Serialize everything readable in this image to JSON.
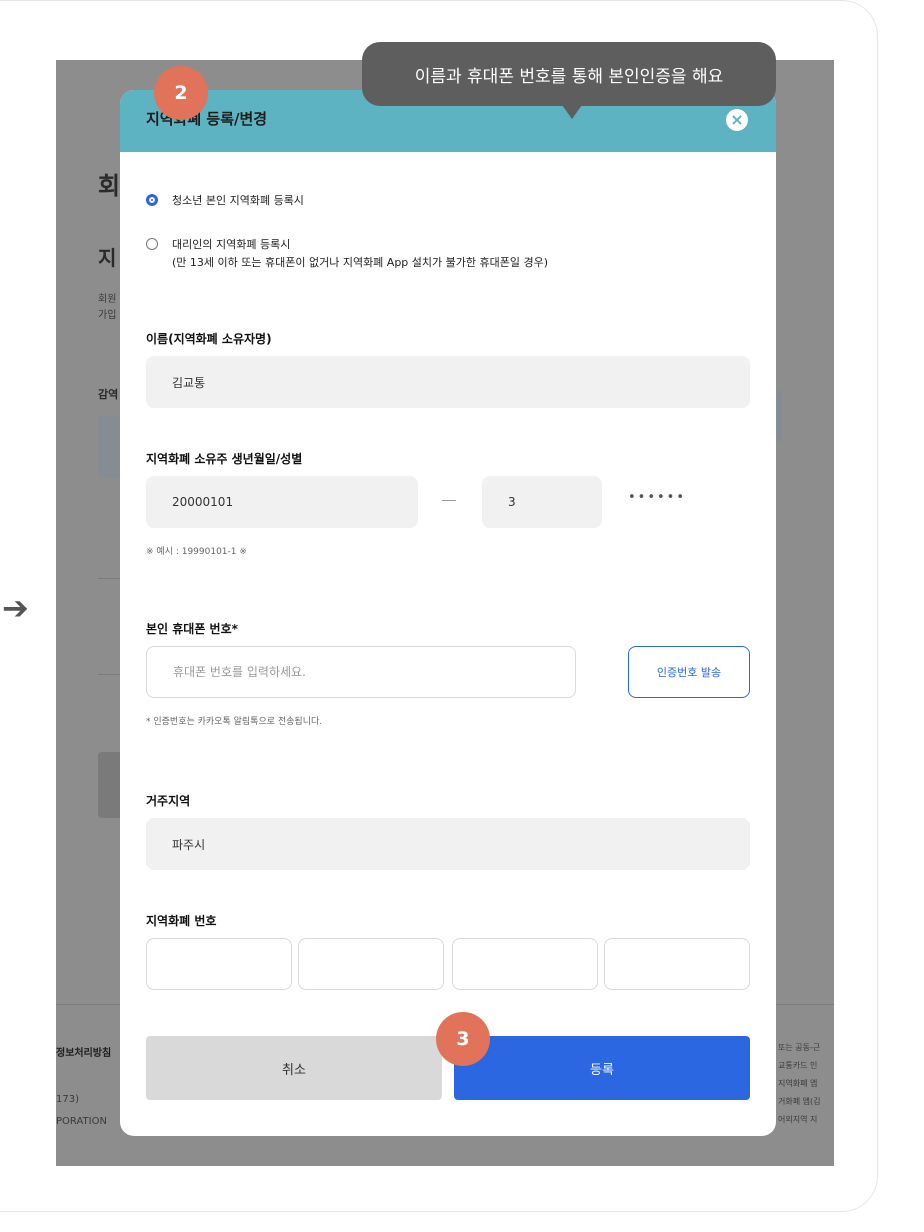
{
  "background_page": {
    "heading_1": "회",
    "heading_2": "지",
    "line_1": "회원",
    "line_2": "가입",
    "label_1": "감역",
    "footer_left_1": "정보처리방침",
    "footer_left_2": "173)",
    "footer_left_3": "PORATION",
    "footer_right": [
      "또는 공동-근",
      "교통카드 인",
      "지역화폐 앱",
      "거화폐 앱(김",
      "어외지역 지"
    ]
  },
  "tooltip": {
    "text": "이름과 휴대폰 번호를 통해 본인인증을 해요"
  },
  "badges": {
    "step_2": "2",
    "step_3": "3"
  },
  "modal": {
    "title": "지역화폐 등록/변경",
    "close_icon": "×",
    "options": [
      {
        "label": "청소년 본인 지역화폐 등록시",
        "selected": true
      },
      {
        "label": "대리인의 지역화폐 등록시",
        "sub": "(만 13세 이하 또는 휴대폰이 없거나 지역화폐 App 설치가 불가한 휴대폰일 경우)",
        "selected": false
      }
    ],
    "name": {
      "label": "이름(지역화폐 소유자명)",
      "value": "김교통"
    },
    "birth": {
      "label": "지역화폐 소유주 생년월일/성별",
      "date_value": "20000101",
      "gender_value": "3",
      "masked": "••••••",
      "hint": "※ 예시 : 19990101-1 ※"
    },
    "phone": {
      "label": "본인 휴대폰 번호*",
      "placeholder": "휴대폰 번호를 입력하세요.",
      "send_button": "인증번호 발송",
      "hint": "* 인증번호는 카카오톡 알림톡으로 전송됩니다."
    },
    "region": {
      "label": "거주지역",
      "value": "파주시"
    },
    "card_number": {
      "label": "지역화폐 번호"
    },
    "cancel_button": "취소",
    "submit_button": "등록"
  }
}
